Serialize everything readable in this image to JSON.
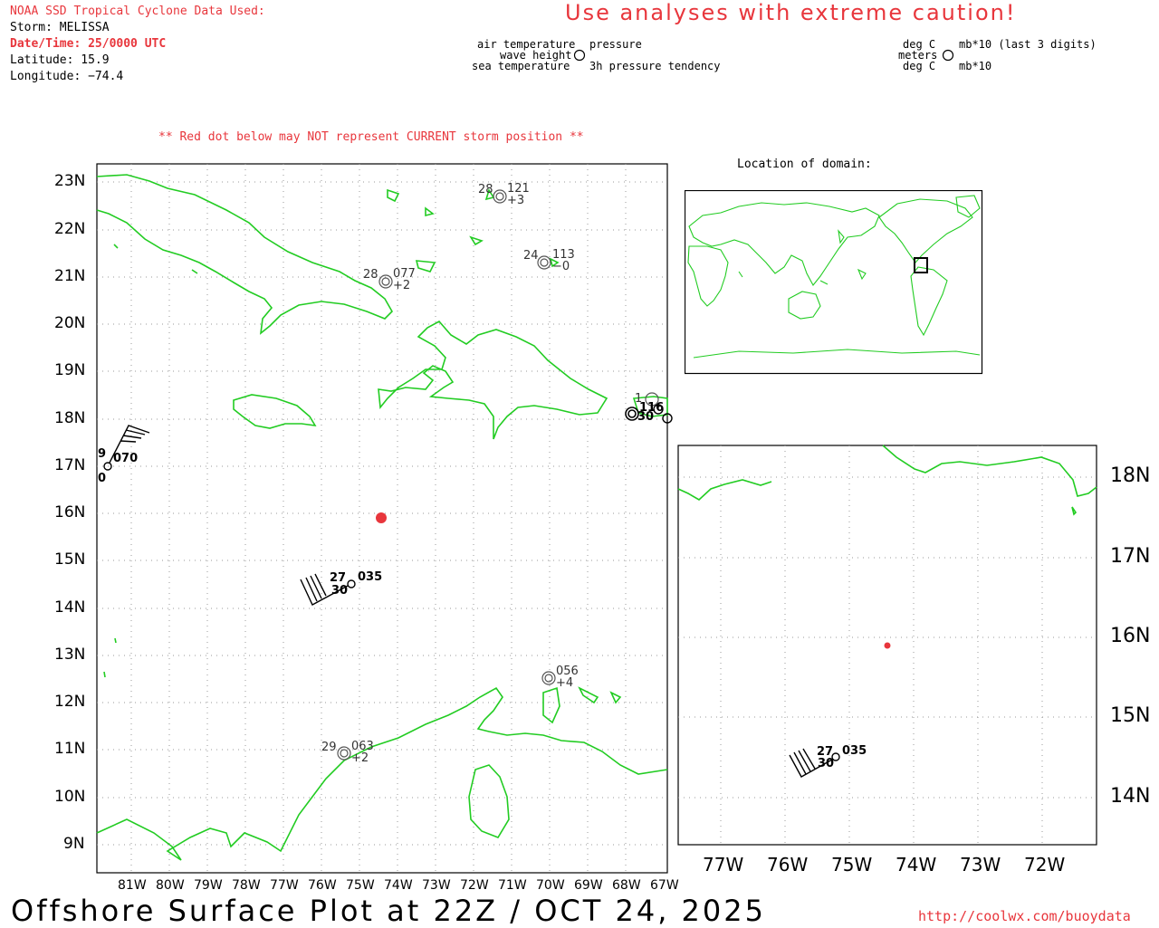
{
  "header": {
    "source_title": "NOAA SSD Tropical Cyclone Data Used:",
    "storm": "Storm: MELISSA",
    "datetime": "Date/Time: 25/0000 UTC",
    "latitude": "Latitude: 15.9",
    "longitude": "Longitude: −74.4",
    "caution": "Use analyses with extreme caution!",
    "red_dot_note": "** Red dot below may NOT represent CURRENT storm position **"
  },
  "legend": {
    "air_temperature": "air temperature",
    "wave_height": "wave height",
    "sea_temperature": "sea temperature",
    "pressure": "pressure",
    "pressure_tendency": "3h pressure tendency",
    "unit_deg_c_1": "deg C",
    "unit_meters": "meters",
    "unit_deg_c_2": "deg C",
    "unit_mb_last3": "mb*10 (last 3 digits)",
    "unit_mb": "mb*10"
  },
  "inset_title": "Location of domain:",
  "main_map": {
    "y_ticks": [
      "23N",
      "22N",
      "21N",
      "20N",
      "19N",
      "18N",
      "17N",
      "16N",
      "15N",
      "14N",
      "13N",
      "12N",
      "11N",
      "10N",
      "9N"
    ],
    "x_ticks": [
      "81W",
      "80W",
      "79W",
      "78W",
      "77W",
      "76W",
      "75W",
      "74W",
      "73W",
      "72W",
      "71W",
      "70W",
      "69W",
      "68W",
      "67W"
    ],
    "storm_marker_color": "#e8363c",
    "coast_color": "#22cc22",
    "stations": [
      {
        "air_temp": "28",
        "pressure": "121",
        "tendency": "+3"
      },
      {
        "air_temp": "24",
        "pressure": "113",
        "tendency": "−0"
      },
      {
        "air_temp": "28",
        "pressure": "077",
        "tendency": "+2"
      },
      {
        "air_temp": "1",
        "pressure": "116",
        "sea_temp": "30"
      },
      {
        "air_temp": "9",
        "pressure": "070",
        "sea_temp": "0"
      },
      {
        "air_temp": "27",
        "pressure": "035",
        "sea_temp": "30"
      },
      {
        "pressure": "056",
        "tendency": "+4"
      },
      {
        "air_temp": "29",
        "pressure": "063",
        "tendency": "+2"
      }
    ]
  },
  "zoom_map": {
    "y_ticks": [
      "18N",
      "17N",
      "16N",
      "15N",
      "14N"
    ],
    "x_ticks": [
      "77W",
      "76W",
      "75W",
      "74W",
      "73W",
      "72W"
    ],
    "station": {
      "air_temp": "27",
      "pressure": "035",
      "sea_temp": "30"
    }
  },
  "footer": {
    "title": "Offshore Surface Plot at 22Z / OCT 24, 2025",
    "url": "http://coolwx.com/buoydata"
  }
}
